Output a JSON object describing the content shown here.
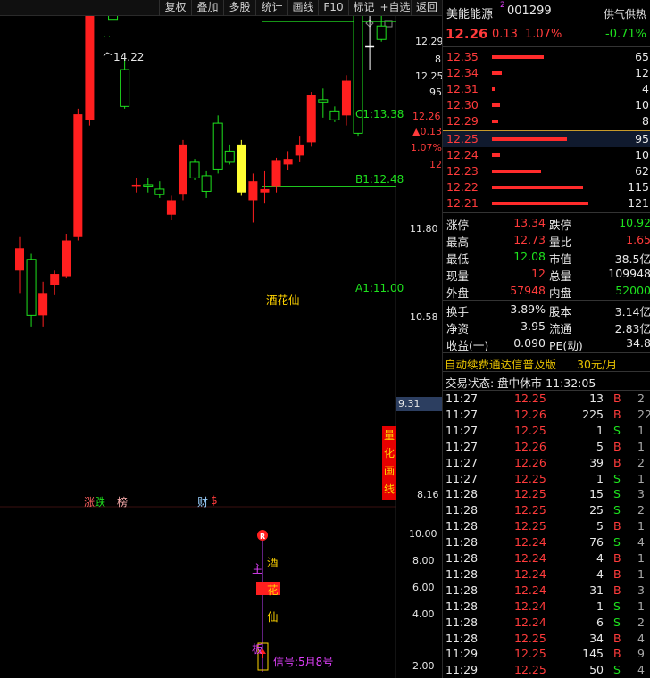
{
  "toolbar": {
    "items": [
      "复权",
      "叠加",
      "多股",
      "统计",
      "画线",
      "F10",
      "标记",
      "+自选",
      "返回"
    ]
  },
  "stock": {
    "name": "美能能源",
    "code": "001299",
    "price": "12.26",
    "change": "0.13",
    "pct": "1.07%",
    "tag": "供气供热",
    "tag_pct": "-0.71%"
  },
  "chart_data": {
    "type": "candlestick",
    "price_axis": [
      "12.29",
      "12.25",
      "11.80",
      "10.58",
      "9.31",
      "8.16"
    ],
    "price_axis_partial": [
      "8",
      "95"
    ],
    "highlight_price": "12.26",
    "highlight_change": "▲0.13",
    "highlight_pct": "1.07%",
    "highlight_extra": "12",
    "high_label": "14.22",
    "lines": [
      {
        "label": "C1:13.38",
        "value": 13.38
      },
      {
        "label": "B1:12.48",
        "value": 12.48
      },
      {
        "label": "A1:11.00",
        "value": 11.0
      }
    ],
    "annotation": "酒花仙",
    "markers": [
      "涨",
      "跌",
      "榜",
      "财",
      "$"
    ],
    "side_button": [
      "量",
      "化",
      "画",
      "线"
    ],
    "candles": [
      {
        "o": 10.25,
        "h": 10.55,
        "l": 10.05,
        "c": 10.45
      },
      {
        "o": 10.35,
        "h": 10.4,
        "l": 9.75,
        "c": 9.85
      },
      {
        "o": 9.85,
        "h": 10.15,
        "l": 9.75,
        "c": 10.05
      },
      {
        "o": 10.12,
        "h": 10.25,
        "l": 10.03,
        "c": 10.22
      },
      {
        "o": 10.2,
        "h": 10.58,
        "l": 10.18,
        "c": 10.52
      },
      {
        "o": 10.55,
        "h": 11.7,
        "l": 10.52,
        "c": 11.65
      },
      {
        "o": 11.6,
        "h": 12.98,
        "l": 11.55,
        "c": 12.95
      },
      {
        "o": 12.9,
        "h": 14.22,
        "l": 12.9,
        "c": 13.88
      },
      {
        "o": 13.7,
        "h": 13.78,
        "l": 12.5,
        "c": 12.5
      },
      {
        "o": 12.05,
        "h": 12.15,
        "l": 11.7,
        "c": 11.72
      },
      {
        "o": 11.0,
        "h": 11.08,
        "l": 10.95,
        "c": 11.02
      },
      {
        "o": 11.02,
        "h": 11.08,
        "l": 10.95,
        "c": 11.0
      },
      {
        "o": 10.98,
        "h": 11.05,
        "l": 10.9,
        "c": 10.93
      },
      {
        "o": 10.75,
        "h": 10.92,
        "l": 10.7,
        "c": 10.88
      },
      {
        "o": 10.93,
        "h": 11.42,
        "l": 10.88,
        "c": 11.38
      },
      {
        "o": 11.22,
        "h": 11.25,
        "l": 11.06,
        "c": 11.08
      },
      {
        "o": 11.1,
        "h": 11.14,
        "l": 10.9,
        "c": 10.96
      },
      {
        "o": 11.57,
        "h": 11.64,
        "l": 11.12,
        "c": 11.16
      },
      {
        "o": 11.32,
        "h": 11.38,
        "l": 11.2,
        "c": 11.22
      },
      {
        "o": 10.95,
        "h": 11.42,
        "l": 10.92,
        "c": 11.38
      },
      {
        "o": 10.88,
        "h": 11.12,
        "l": 10.68,
        "c": 11.05
      },
      {
        "o": 10.95,
        "h": 11.14,
        "l": 10.85,
        "c": 10.98
      },
      {
        "o": 11.0,
        "h": 11.26,
        "l": 10.95,
        "c": 11.24
      },
      {
        "o": 11.2,
        "h": 11.32,
        "l": 11.15,
        "c": 11.25
      },
      {
        "o": 11.28,
        "h": 11.45,
        "l": 11.22,
        "c": 11.38
      },
      {
        "o": 11.4,
        "h": 11.85,
        "l": 11.36,
        "c": 11.82
      },
      {
        "o": 11.78,
        "h": 11.88,
        "l": 11.62,
        "c": 11.76
      },
      {
        "o": 11.68,
        "h": 11.72,
        "l": 11.58,
        "c": 11.6
      },
      {
        "o": 11.64,
        "h": 12.0,
        "l": 11.55,
        "c": 11.95
      },
      {
        "o": 12.58,
        "h": 12.62,
        "l": 11.45,
        "c": 11.48
      },
      {
        "o": 12.26,
        "h": 12.55,
        "l": 12.05,
        "c": 12.26
      },
      {
        "o": 12.44,
        "h": 12.73,
        "l": 12.3,
        "c": 12.32
      }
    ],
    "sub_axis": [
      "10.00",
      "8.00",
      "6.00",
      "4.00",
      "2.00"
    ],
    "sub_labels": {
      "zhu": "主",
      "ban": "板",
      "jiu": "酒",
      "hua": "花",
      "xian": "仙",
      "signal": "信号:5月8号"
    }
  },
  "order_book": {
    "asks": [
      {
        "price": "12.35",
        "vol": "65",
        "w": 58
      },
      {
        "price": "12.34",
        "vol": "12",
        "w": 11
      },
      {
        "price": "12.31",
        "vol": "4",
        "w": 3
      },
      {
        "price": "12.30",
        "vol": "10",
        "w": 9
      },
      {
        "price": "12.29",
        "vol": "8",
        "w": 7
      }
    ],
    "bids": [
      {
        "price": "12.25",
        "vol": "95",
        "w": 84
      },
      {
        "price": "12.24",
        "vol": "10",
        "w": 9
      },
      {
        "price": "12.23",
        "vol": "62",
        "w": 55
      },
      {
        "price": "12.22",
        "vol": "115",
        "w": 102
      },
      {
        "price": "12.21",
        "vol": "121",
        "w": 108
      }
    ]
  },
  "stats": [
    {
      "l": "涨停",
      "v": "13.34",
      "vc": "red",
      "l2": "跌停",
      "v2": "10.92",
      "v2c": "green"
    },
    {
      "l": "最高",
      "v": "12.73",
      "vc": "red",
      "l2": "量比",
      "v2": "1.65",
      "v2c": "red"
    },
    {
      "l": "最低",
      "v": "12.08",
      "vc": "green",
      "l2": "市值",
      "v2": "38.5亿",
      "v2c": "white"
    },
    {
      "l": "现量",
      "v": "12",
      "vc": "red",
      "l2": "总量",
      "v2": "109948",
      "v2c": "white"
    },
    {
      "l": "外盘",
      "v": "57948",
      "vc": "red",
      "l2": "内盘",
      "v2": "52000",
      "v2c": "green"
    }
  ],
  "stats2": [
    {
      "l": "换手",
      "v": "3.89%",
      "l2": "股本",
      "v2": "3.14亿"
    },
    {
      "l": "净资",
      "v": "3.95",
      "l2": "流通",
      "v2": "2.83亿"
    },
    {
      "l": "收益(一)",
      "v": "0.090",
      "l2": "PE(动)",
      "v2": "34.8"
    }
  ],
  "promo": {
    "text": "自动续费通达信普及版",
    "price": "30元/月"
  },
  "trade_status": "交易状态: 盘中休市 11:32:05",
  "ticks": [
    {
      "t": "11:27",
      "p": "12.25",
      "v": "13",
      "s": "B",
      "n": "2"
    },
    {
      "t": "11:27",
      "p": "12.26",
      "v": "225",
      "s": "B",
      "n": "22"
    },
    {
      "t": "11:27",
      "p": "12.25",
      "v": "1",
      "s": "S",
      "n": "1"
    },
    {
      "t": "11:27",
      "p": "12.26",
      "v": "5",
      "s": "B",
      "n": "1"
    },
    {
      "t": "11:27",
      "p": "12.26",
      "v": "39",
      "s": "B",
      "n": "2"
    },
    {
      "t": "11:27",
      "p": "12.25",
      "v": "1",
      "s": "S",
      "n": "1"
    },
    {
      "t": "11:28",
      "p": "12.25",
      "v": "15",
      "s": "S",
      "n": "3"
    },
    {
      "t": "11:28",
      "p": "12.25",
      "v": "25",
      "s": "S",
      "n": "2"
    },
    {
      "t": "11:28",
      "p": "12.25",
      "v": "5",
      "s": "B",
      "n": "1"
    },
    {
      "t": "11:28",
      "p": "12.24",
      "v": "76",
      "s": "S",
      "n": "4"
    },
    {
      "t": "11:28",
      "p": "12.24",
      "v": "4",
      "s": "B",
      "n": "1"
    },
    {
      "t": "11:28",
      "p": "12.24",
      "v": "4",
      "s": "B",
      "n": "1"
    },
    {
      "t": "11:28",
      "p": "12.24",
      "v": "31",
      "s": "B",
      "n": "3"
    },
    {
      "t": "11:28",
      "p": "12.24",
      "v": "1",
      "s": "S",
      "n": "1"
    },
    {
      "t": "11:28",
      "p": "12.24",
      "v": "6",
      "s": "S",
      "n": "2"
    },
    {
      "t": "11:28",
      "p": "12.25",
      "v": "34",
      "s": "B",
      "n": "4"
    },
    {
      "t": "11:29",
      "p": "12.25",
      "v": "145",
      "s": "B",
      "n": "9"
    },
    {
      "t": "11:29",
      "p": "12.25",
      "v": "50",
      "s": "S",
      "n": "4"
    }
  ]
}
